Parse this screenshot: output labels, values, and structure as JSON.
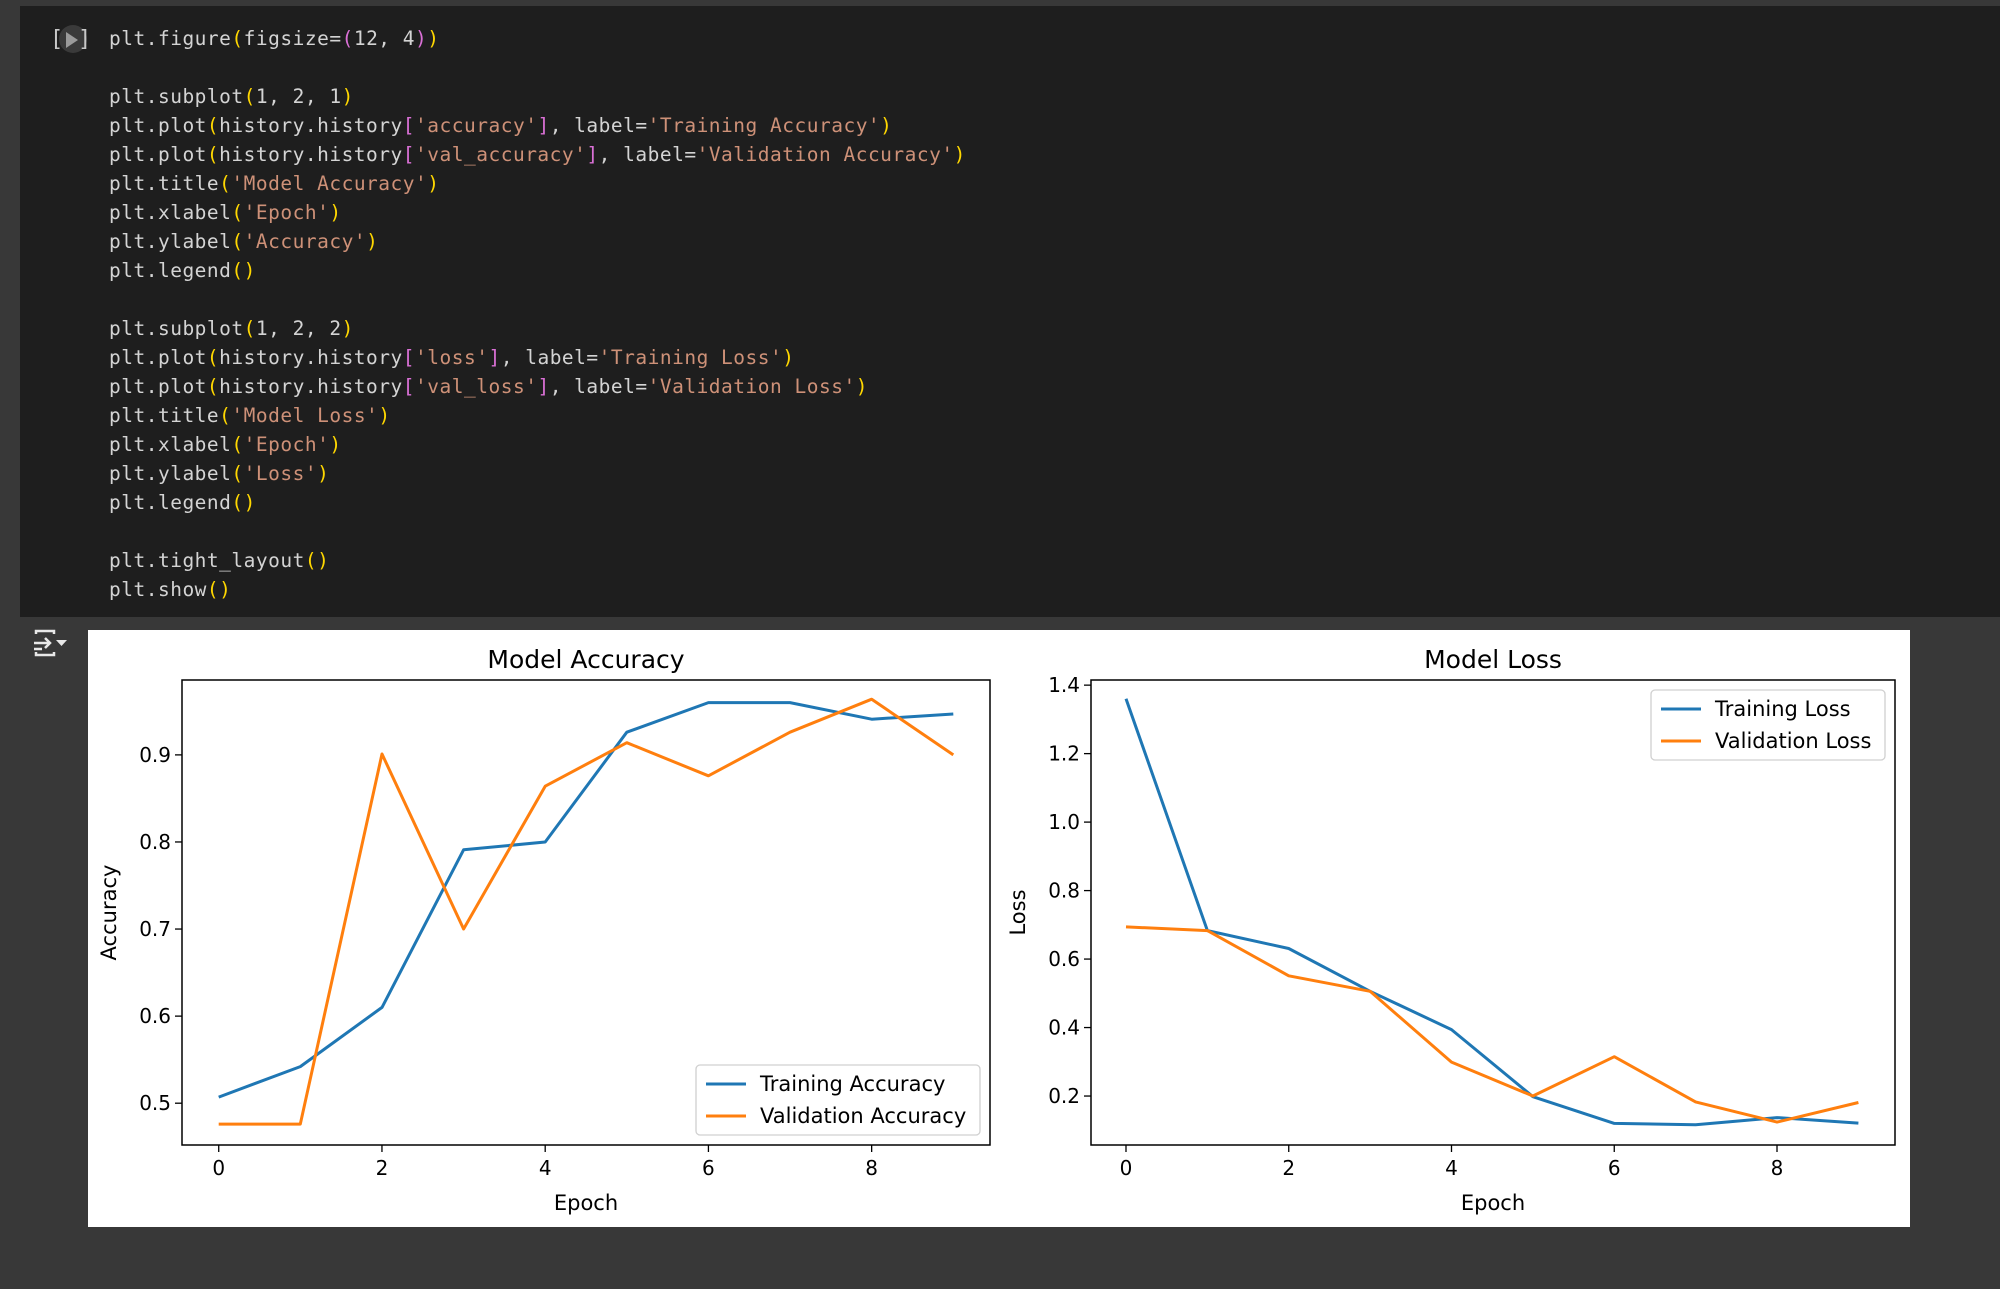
{
  "cell": {
    "run_icon": "play-icon",
    "code_lines": [
      [
        {
          "t": "plt.figure",
          "c": ""
        },
        {
          "t": "(",
          "c": "p1"
        },
        {
          "t": "figsize=",
          "c": ""
        },
        {
          "t": "(",
          "c": "p2"
        },
        {
          "t": "12, 4",
          "c": ""
        },
        {
          "t": ")",
          "c": "p2"
        },
        {
          "t": ")",
          "c": "p1"
        }
      ],
      [],
      [
        {
          "t": "plt.subplot",
          "c": ""
        },
        {
          "t": "(",
          "c": "p1"
        },
        {
          "t": "1, 2, 1",
          "c": ""
        },
        {
          "t": ")",
          "c": "p1"
        }
      ],
      [
        {
          "t": "plt.plot",
          "c": ""
        },
        {
          "t": "(",
          "c": "p1"
        },
        {
          "t": "history.history",
          "c": ""
        },
        {
          "t": "[",
          "c": "p2"
        },
        {
          "t": "'accuracy'",
          "c": "s"
        },
        {
          "t": "]",
          "c": "p2"
        },
        {
          "t": ", label=",
          "c": ""
        },
        {
          "t": "'Training Accuracy'",
          "c": "s"
        },
        {
          "t": ")",
          "c": "p1"
        }
      ],
      [
        {
          "t": "plt.plot",
          "c": ""
        },
        {
          "t": "(",
          "c": "p1"
        },
        {
          "t": "history.history",
          "c": ""
        },
        {
          "t": "[",
          "c": "p2"
        },
        {
          "t": "'val_accuracy'",
          "c": "s"
        },
        {
          "t": "]",
          "c": "p2"
        },
        {
          "t": ", label=",
          "c": ""
        },
        {
          "t": "'Validation Accuracy'",
          "c": "s"
        },
        {
          "t": ")",
          "c": "p1"
        }
      ],
      [
        {
          "t": "plt.title",
          "c": ""
        },
        {
          "t": "(",
          "c": "p1"
        },
        {
          "t": "'Model Accuracy'",
          "c": "s"
        },
        {
          "t": ")",
          "c": "p1"
        }
      ],
      [
        {
          "t": "plt.xlabel",
          "c": ""
        },
        {
          "t": "(",
          "c": "p1"
        },
        {
          "t": "'Epoch'",
          "c": "s"
        },
        {
          "t": ")",
          "c": "p1"
        }
      ],
      [
        {
          "t": "plt.ylabel",
          "c": ""
        },
        {
          "t": "(",
          "c": "p1"
        },
        {
          "t": "'Accuracy'",
          "c": "s"
        },
        {
          "t": ")",
          "c": "p1"
        }
      ],
      [
        {
          "t": "plt.legend",
          "c": ""
        },
        {
          "t": "()",
          "c": "p1"
        }
      ],
      [],
      [
        {
          "t": "plt.subplot",
          "c": ""
        },
        {
          "t": "(",
          "c": "p1"
        },
        {
          "t": "1, 2, 2",
          "c": ""
        },
        {
          "t": ")",
          "c": "p1"
        }
      ],
      [
        {
          "t": "plt.plot",
          "c": ""
        },
        {
          "t": "(",
          "c": "p1"
        },
        {
          "t": "history.history",
          "c": ""
        },
        {
          "t": "[",
          "c": "p2"
        },
        {
          "t": "'loss'",
          "c": "s"
        },
        {
          "t": "]",
          "c": "p2"
        },
        {
          "t": ", label=",
          "c": ""
        },
        {
          "t": "'Training Loss'",
          "c": "s"
        },
        {
          "t": ")",
          "c": "p1"
        }
      ],
      [
        {
          "t": "plt.plot",
          "c": ""
        },
        {
          "t": "(",
          "c": "p1"
        },
        {
          "t": "history.history",
          "c": ""
        },
        {
          "t": "[",
          "c": "p2"
        },
        {
          "t": "'val_loss'",
          "c": "s"
        },
        {
          "t": "]",
          "c": "p2"
        },
        {
          "t": ", label=",
          "c": ""
        },
        {
          "t": "'Validation Loss'",
          "c": "s"
        },
        {
          "t": ")",
          "c": "p1"
        }
      ],
      [
        {
          "t": "plt.title",
          "c": ""
        },
        {
          "t": "(",
          "c": "p1"
        },
        {
          "t": "'Model Loss'",
          "c": "s"
        },
        {
          "t": ")",
          "c": "p1"
        }
      ],
      [
        {
          "t": "plt.xlabel",
          "c": ""
        },
        {
          "t": "(",
          "c": "p1"
        },
        {
          "t": "'Epoch'",
          "c": "s"
        },
        {
          "t": ")",
          "c": "p1"
        }
      ],
      [
        {
          "t": "plt.ylabel",
          "c": ""
        },
        {
          "t": "(",
          "c": "p1"
        },
        {
          "t": "'Loss'",
          "c": "s"
        },
        {
          "t": ")",
          "c": "p1"
        }
      ],
      [
        {
          "t": "plt.legend",
          "c": ""
        },
        {
          "t": "()",
          "c": "p1"
        }
      ],
      [],
      [
        {
          "t": "plt.tight_layout",
          "c": ""
        },
        {
          "t": "()",
          "c": "p1"
        }
      ],
      [
        {
          "t": "plt.show",
          "c": ""
        },
        {
          "t": "()",
          "c": "p1"
        }
      ]
    ]
  },
  "output": {
    "toggle_icon": "output-toggle-icon"
  },
  "colors": {
    "training": "#1f77b4",
    "validation": "#ff7f0e"
  },
  "chart_data": [
    {
      "type": "line",
      "title": "Model Accuracy",
      "xlabel": "Epoch",
      "ylabel": "Accuracy",
      "x": [
        0,
        1,
        2,
        3,
        4,
        5,
        6,
        7,
        8,
        9
      ],
      "xlim": [
        -0.45,
        9.45
      ],
      "ylim": [
        0.452,
        0.986
      ],
      "xticks": [
        0,
        2,
        4,
        6,
        8
      ],
      "yticks": [
        0.5,
        0.6,
        0.7,
        0.8,
        0.9
      ],
      "ytick_labels": [
        "0.5",
        "0.6",
        "0.7",
        "0.8",
        "0.9"
      ],
      "grid": false,
      "legend_placement": "lower-right",
      "series": [
        {
          "name": "Training Accuracy",
          "values": [
            0.507,
            0.542,
            0.61,
            0.791,
            0.8,
            0.926,
            0.96,
            0.96,
            0.941,
            0.947
          ]
        },
        {
          "name": "Validation Accuracy",
          "values": [
            0.476,
            0.476,
            0.901,
            0.7,
            0.864,
            0.914,
            0.876,
            0.926,
            0.964,
            0.9
          ]
        }
      ]
    },
    {
      "type": "line",
      "title": "Model Loss",
      "xlabel": "Epoch",
      "ylabel": "Loss",
      "x": [
        0,
        1,
        2,
        3,
        4,
        5,
        6,
        7,
        8,
        9
      ],
      "xlim": [
        -0.43,
        9.45
      ],
      "ylim": [
        0.057,
        1.415
      ],
      "xticks": [
        0,
        2,
        4,
        6,
        8
      ],
      "yticks": [
        0.2,
        0.4,
        0.6,
        0.8,
        1.0,
        1.2,
        1.4
      ],
      "ytick_labels": [
        "0.2",
        "0.4",
        "0.6",
        "0.8",
        "1.0",
        "1.2",
        "1.4"
      ],
      "grid": false,
      "legend_placement": "upper-right",
      "series": [
        {
          "name": "Training Loss",
          "values": [
            1.36,
            0.683,
            0.631,
            0.506,
            0.394,
            0.198,
            0.12,
            0.116,
            0.137,
            0.121
          ]
        },
        {
          "name": "Validation Loss",
          "values": [
            0.694,
            0.683,
            0.551,
            0.506,
            0.299,
            0.2,
            0.315,
            0.183,
            0.124,
            0.181
          ]
        }
      ]
    }
  ]
}
